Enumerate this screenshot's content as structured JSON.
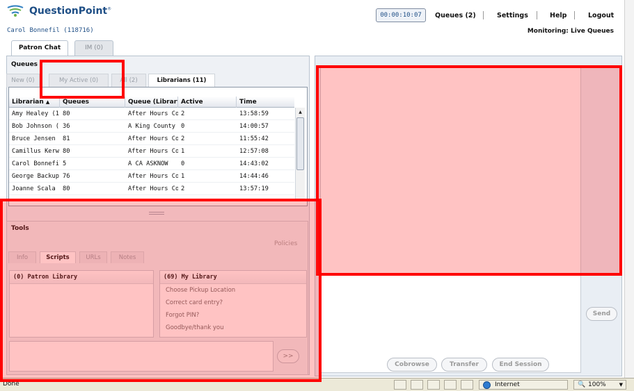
{
  "brand": {
    "name": "QuestionPoint"
  },
  "header": {
    "user": "Carol Bonnefil (118716)",
    "timer": "00:00:10:07",
    "nav": [
      "Queues (2)",
      "Settings",
      "Help",
      "Logout"
    ],
    "monitoring": "Monitoring: Live Queues"
  },
  "main_tabs": [
    "Patron Chat",
    "IM (0)"
  ],
  "queues": {
    "title": "Queues",
    "tabs": [
      "New (0)",
      "My Active (0)",
      "All (2)",
      "Librarians (11)"
    ],
    "columns": [
      "Librarian",
      "Queues",
      "Queue (Library",
      "Active",
      "Time"
    ],
    "rows": [
      [
        "Amy Healey (1",
        "80",
        "After Hours Co",
        "2",
        "13:58:59"
      ],
      [
        "Bob Johnson (:",
        "36",
        "A King County",
        "0",
        "14:00:57"
      ],
      [
        "Bruce Jensen (",
        "81",
        "After Hours Co",
        "2",
        "11:55:42"
      ],
      [
        "Camillus Kerwir",
        "80",
        "After Hours Co",
        "1",
        "12:57:08"
      ],
      [
        "Carol Bonnefil",
        "5",
        "A CA ASKNOW",
        "0",
        "14:43:02"
      ],
      [
        "George Backup",
        "76",
        "After Hours Co",
        "1",
        "14:44:46"
      ],
      [
        "Joanne Scala (",
        "80",
        "After Hours Co",
        "2",
        "13:57:19"
      ]
    ]
  },
  "tools": {
    "title": "Tools",
    "policies": "Policies",
    "tabs": [
      "Info",
      "Scripts",
      "URLs",
      "Notes"
    ],
    "patron_library_title": "(0) Patron Library",
    "my_library_title": "(69) My Library",
    "my_library_items": [
      "Choose Pickup Location",
      "Correct card entry?",
      "Forgot PIN?",
      "Goodbye/thank you"
    ],
    "insert_label": ">>"
  },
  "chat": {
    "send_label": "Send",
    "buttons": [
      "Cobrowse",
      "Transfer",
      "End Session"
    ]
  },
  "statusbar": {
    "status": "Done",
    "zone": "Internet",
    "zoom": "100%"
  },
  "colors": {
    "brand_blue": "#1f4f86",
    "highlight_red": "#ff0000"
  }
}
